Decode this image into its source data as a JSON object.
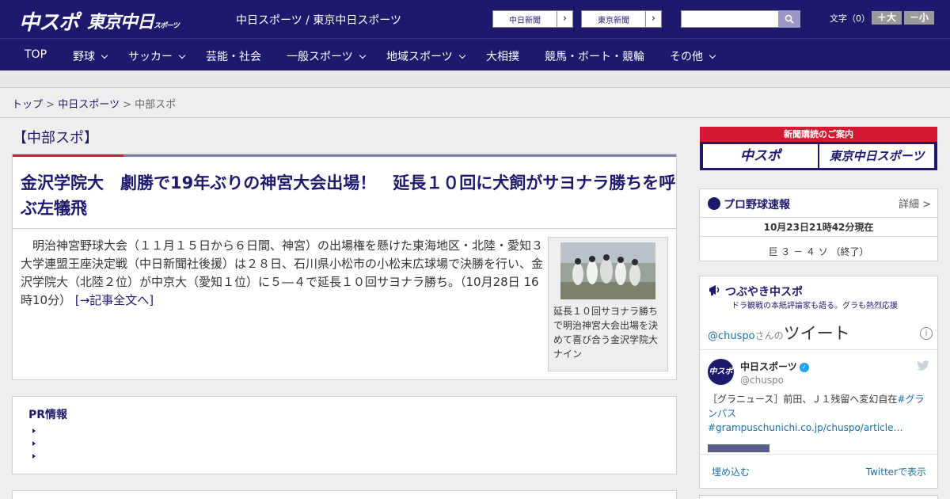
{
  "header": {
    "logo_chuspo": "中スポ",
    "logo_tokyo": "東京中日",
    "logo_tokyo_small": "スポーツ",
    "site_link": "中日スポーツ / 東京中日スポーツ",
    "btn_chunichi": "中日新聞",
    "btn_tokyo": "東京新聞",
    "search_placeholder": "",
    "fontsize_label": "文字（0）",
    "fontsize_up": "＋大",
    "fontsize_down": "－小"
  },
  "nav": {
    "items": [
      {
        "label": "TOP"
      },
      {
        "label": "野球"
      },
      {
        "label": "サッカー"
      },
      {
        "label": "芸能・社会"
      },
      {
        "label": "一般スポーツ"
      },
      {
        "label": "地域スポーツ"
      },
      {
        "label": "大相撲"
      },
      {
        "label": "競馬・ボート・競輪"
      },
      {
        "label": "その他"
      }
    ]
  },
  "breadcrumb": {
    "top": "トップ",
    "chunichi": "中日スポーツ",
    "current": "中部スポ",
    "sep": ">"
  },
  "section": {
    "title": "【中部スポ】"
  },
  "article": {
    "headline": "金沢学院大　劇勝で19年ぶりの神宮大会出場！　延長１０回に犬飼がサヨナラ勝ちを呼ぶ左犠飛",
    "body": "明治神宮野球大会（１１月１５日から６日間、神宮）の出場権を懸けた東海地区・北陸・愛知３大学連盟王座決定戦（中日新聞社後援）は２８日、石川県小松市の小松末広球場で決勝を行い、金沢学院大（北陸２位）が中京大（愛知１位）に５―４で延長１０回サヨナラ勝ち。（10月28日 16時10分）",
    "more_link": "[→記事全文へ]",
    "photo_caption": "延長１０回サヨナラ勝ちで明治神宮大会出場を決めて喜び合う金沢学院大ナイン"
  },
  "pr": {
    "title": "PR情報"
  },
  "subscription": {
    "banner": "新聞購読のご案内",
    "tile_a": "中スポ",
    "tile_b": "東京中日スポーツ"
  },
  "baseball": {
    "title": "プロ野球速報",
    "detail": "詳細 >",
    "time": "10月23日21時42分現在",
    "score": "巨 ３ － ４ ソ （終了）"
  },
  "tweets": {
    "title": "つぶやき中スポ",
    "subtitle": "ドラ観戦の本紙評論家も語る。グラも熱烈応援",
    "handle": "@chuspo",
    "san": "さんの",
    "word": "ツイート",
    "avatar": "中スポ",
    "name": "中日スポーツ",
    "user": "@chuspo",
    "text_a": "［グラニュース］前田、Ｊ１残留へ変幻自在",
    "text_tag": "#グランパス #grampuschunichi.co.jp/chuspo/article…",
    "embed": "埋め込む",
    "view": "Twitterで表示"
  },
  "colors": {
    "brand_navy": "#1d1a6e",
    "accent_red": "#d51935",
    "link_blue": "#1d6fa5"
  }
}
